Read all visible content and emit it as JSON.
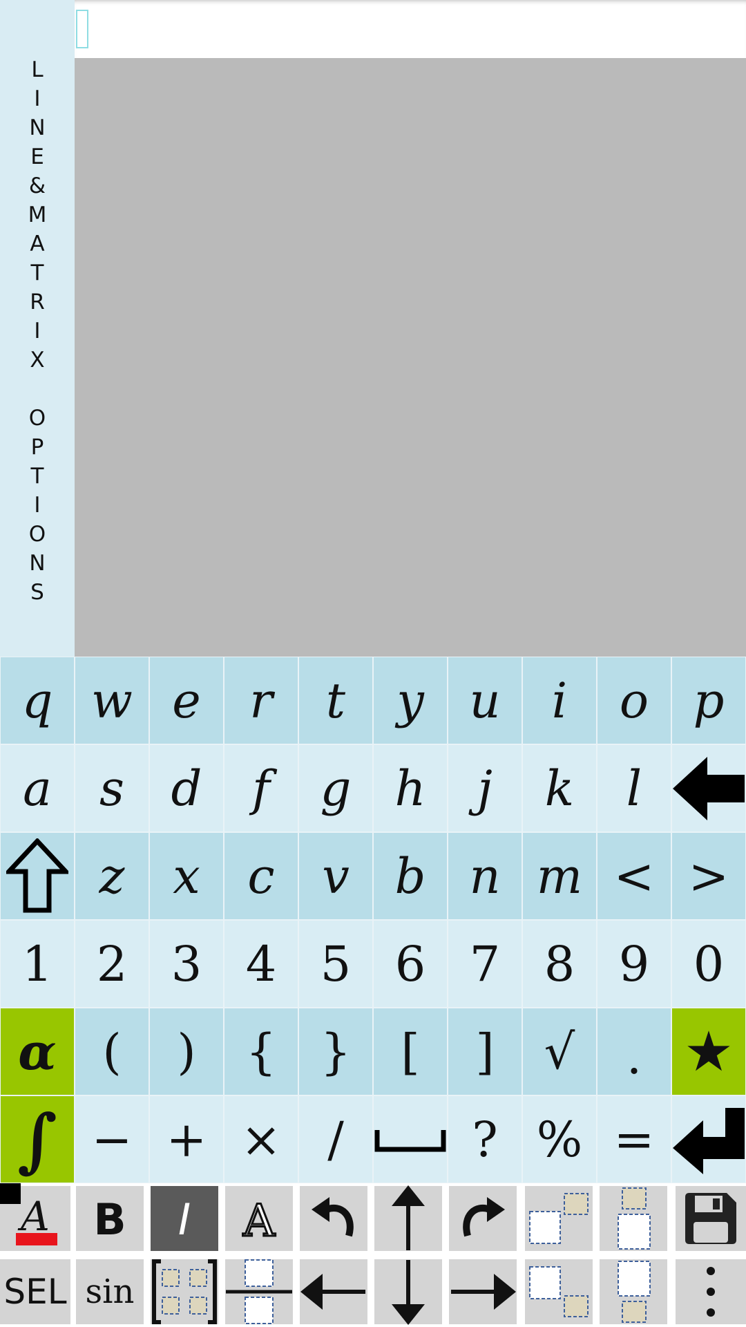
{
  "side_panel": {
    "label_chars": [
      "L",
      "I",
      "N",
      "E",
      "&",
      "M",
      "A",
      "T",
      "R",
      "I",
      "X",
      " ",
      "O",
      "P",
      "T",
      "I",
      "O",
      "N",
      "S"
    ]
  },
  "keyboard": {
    "rows": [
      {
        "style": "dark",
        "keys": [
          "q",
          "w",
          "e",
          "r",
          "t",
          "y",
          "u",
          "i",
          "o",
          "p"
        ]
      },
      {
        "style": "light",
        "keys": [
          "a",
          "s",
          "d",
          "f",
          "g",
          "h",
          "j",
          "k",
          "l",
          "backspace-icon"
        ]
      },
      {
        "style": "dark",
        "keys": [
          "shift-icon",
          "z",
          "x",
          "c",
          "v",
          "b",
          "n",
          "m",
          "<",
          ">"
        ]
      },
      {
        "style": "light",
        "keys": [
          "1",
          "2",
          "3",
          "4",
          "5",
          "6",
          "7",
          "8",
          "9",
          "0"
        ]
      },
      {
        "style": "dark",
        "keys": [
          "α",
          "(",
          ")",
          "{",
          "}",
          "[",
          "]",
          "√",
          ".",
          "★"
        ]
      },
      {
        "style": "light",
        "keys": [
          "∫",
          "−",
          "+",
          "×",
          "/",
          "space-icon",
          "?",
          "%",
          "=",
          "enter-icon"
        ]
      }
    ],
    "green_key_color": "#98c600"
  },
  "toolbar": {
    "row1": [
      "text-color-icon",
      "bold-icon",
      "italic-icon",
      "outline-font-icon",
      "undo-icon",
      "up-arrow-icon",
      "redo-icon",
      "superscript-icon",
      "above-icon",
      "save-icon"
    ],
    "row2": [
      "SEL",
      "sin",
      "matrix-icon",
      "fraction-icon",
      "left-arrow-icon",
      "down-arrow-icon",
      "right-arrow-icon",
      "subscript-icon",
      "below-icon",
      "more-icon"
    ],
    "bold_label": "B",
    "italic_label": "I",
    "outline_label": "A",
    "sel_label": "SEL",
    "sin_label": "sin",
    "text_color_label": "A",
    "text_color": "#e8141c"
  }
}
